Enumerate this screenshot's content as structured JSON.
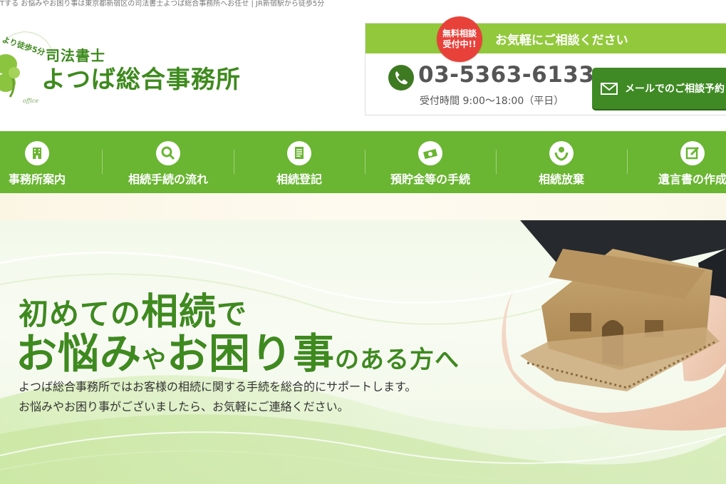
{
  "top_strip": "Tする お悩みやお困り事は東京都新宿区の司法書士よつば総合事務所へお任せ | JR新宿駅から徒歩5分",
  "logo": {
    "small": "司法書士",
    "big": "よつば総合事務所",
    "arc_text": "より徒歩5分",
    "sub_text": "office"
  },
  "contact": {
    "badge_line1": "無料相談",
    "badge_line2": "受付中!!",
    "bar_text": "お気軽にご相談ください",
    "phone": "03-5363-6133",
    "hours": "受付時間 9:00〜18:00（平日）",
    "mail_button": "メールでのご相談予約"
  },
  "nav": [
    {
      "label": "事務所案内",
      "icon": "building-icon"
    },
    {
      "label": "相続手続の流れ",
      "icon": "search-icon"
    },
    {
      "label": "相続登記",
      "icon": "document-icon"
    },
    {
      "label": "預貯金等の手続",
      "icon": "money-icon"
    },
    {
      "label": "相続放棄",
      "icon": "hands-icon"
    },
    {
      "label": "遺言書の作成",
      "icon": "pencil-icon"
    }
  ],
  "hero": {
    "line1_a": "初めての",
    "line1_b": "相続",
    "line1_c": "で",
    "line2_a": "お悩み",
    "line2_b": "や",
    "line2_c": "お困り事",
    "line2_d": "のある方へ",
    "p1": "よつば総合事務所ではお客様の相続に関する手続を総合的にサポートします。",
    "p2": "お悩みやお困り事がございましたら、お気軽にご連絡ください。"
  },
  "colors": {
    "green_dark": "#3e8a1e",
    "green_nav": "#6ab532",
    "green_bar": "#92c93c",
    "badge_red": "#e8413a"
  }
}
